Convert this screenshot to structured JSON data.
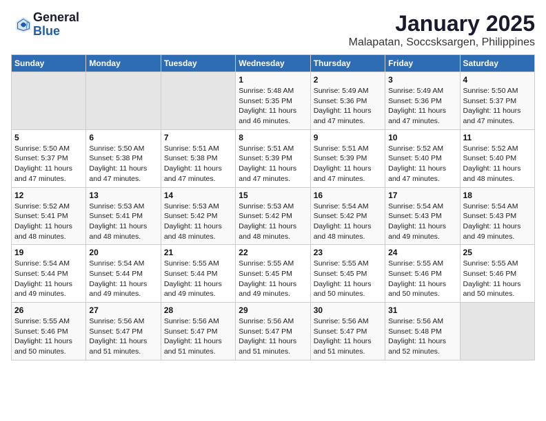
{
  "logo": {
    "general": "General",
    "blue": "Blue"
  },
  "title": "January 2025",
  "subtitle": "Malapatan, Soccsksargen, Philippines",
  "days_of_week": [
    "Sunday",
    "Monday",
    "Tuesday",
    "Wednesday",
    "Thursday",
    "Friday",
    "Saturday"
  ],
  "weeks": [
    [
      {
        "day": "",
        "info": ""
      },
      {
        "day": "",
        "info": ""
      },
      {
        "day": "",
        "info": ""
      },
      {
        "day": "1",
        "info": "Sunrise: 5:48 AM\nSunset: 5:35 PM\nDaylight: 11 hours and 46 minutes."
      },
      {
        "day": "2",
        "info": "Sunrise: 5:49 AM\nSunset: 5:36 PM\nDaylight: 11 hours and 47 minutes."
      },
      {
        "day": "3",
        "info": "Sunrise: 5:49 AM\nSunset: 5:36 PM\nDaylight: 11 hours and 47 minutes."
      },
      {
        "day": "4",
        "info": "Sunrise: 5:50 AM\nSunset: 5:37 PM\nDaylight: 11 hours and 47 minutes."
      }
    ],
    [
      {
        "day": "5",
        "info": "Sunrise: 5:50 AM\nSunset: 5:37 PM\nDaylight: 11 hours and 47 minutes."
      },
      {
        "day": "6",
        "info": "Sunrise: 5:50 AM\nSunset: 5:38 PM\nDaylight: 11 hours and 47 minutes."
      },
      {
        "day": "7",
        "info": "Sunrise: 5:51 AM\nSunset: 5:38 PM\nDaylight: 11 hours and 47 minutes."
      },
      {
        "day": "8",
        "info": "Sunrise: 5:51 AM\nSunset: 5:39 PM\nDaylight: 11 hours and 47 minutes."
      },
      {
        "day": "9",
        "info": "Sunrise: 5:51 AM\nSunset: 5:39 PM\nDaylight: 11 hours and 47 minutes."
      },
      {
        "day": "10",
        "info": "Sunrise: 5:52 AM\nSunset: 5:40 PM\nDaylight: 11 hours and 47 minutes."
      },
      {
        "day": "11",
        "info": "Sunrise: 5:52 AM\nSunset: 5:40 PM\nDaylight: 11 hours and 48 minutes."
      }
    ],
    [
      {
        "day": "12",
        "info": "Sunrise: 5:52 AM\nSunset: 5:41 PM\nDaylight: 11 hours and 48 minutes."
      },
      {
        "day": "13",
        "info": "Sunrise: 5:53 AM\nSunset: 5:41 PM\nDaylight: 11 hours and 48 minutes."
      },
      {
        "day": "14",
        "info": "Sunrise: 5:53 AM\nSunset: 5:42 PM\nDaylight: 11 hours and 48 minutes."
      },
      {
        "day": "15",
        "info": "Sunrise: 5:53 AM\nSunset: 5:42 PM\nDaylight: 11 hours and 48 minutes."
      },
      {
        "day": "16",
        "info": "Sunrise: 5:54 AM\nSunset: 5:42 PM\nDaylight: 11 hours and 48 minutes."
      },
      {
        "day": "17",
        "info": "Sunrise: 5:54 AM\nSunset: 5:43 PM\nDaylight: 11 hours and 49 minutes."
      },
      {
        "day": "18",
        "info": "Sunrise: 5:54 AM\nSunset: 5:43 PM\nDaylight: 11 hours and 49 minutes."
      }
    ],
    [
      {
        "day": "19",
        "info": "Sunrise: 5:54 AM\nSunset: 5:44 PM\nDaylight: 11 hours and 49 minutes."
      },
      {
        "day": "20",
        "info": "Sunrise: 5:54 AM\nSunset: 5:44 PM\nDaylight: 11 hours and 49 minutes."
      },
      {
        "day": "21",
        "info": "Sunrise: 5:55 AM\nSunset: 5:44 PM\nDaylight: 11 hours and 49 minutes."
      },
      {
        "day": "22",
        "info": "Sunrise: 5:55 AM\nSunset: 5:45 PM\nDaylight: 11 hours and 49 minutes."
      },
      {
        "day": "23",
        "info": "Sunrise: 5:55 AM\nSunset: 5:45 PM\nDaylight: 11 hours and 50 minutes."
      },
      {
        "day": "24",
        "info": "Sunrise: 5:55 AM\nSunset: 5:46 PM\nDaylight: 11 hours and 50 minutes."
      },
      {
        "day": "25",
        "info": "Sunrise: 5:55 AM\nSunset: 5:46 PM\nDaylight: 11 hours and 50 minutes."
      }
    ],
    [
      {
        "day": "26",
        "info": "Sunrise: 5:55 AM\nSunset: 5:46 PM\nDaylight: 11 hours and 50 minutes."
      },
      {
        "day": "27",
        "info": "Sunrise: 5:56 AM\nSunset: 5:47 PM\nDaylight: 11 hours and 51 minutes."
      },
      {
        "day": "28",
        "info": "Sunrise: 5:56 AM\nSunset: 5:47 PM\nDaylight: 11 hours and 51 minutes."
      },
      {
        "day": "29",
        "info": "Sunrise: 5:56 AM\nSunset: 5:47 PM\nDaylight: 11 hours and 51 minutes."
      },
      {
        "day": "30",
        "info": "Sunrise: 5:56 AM\nSunset: 5:47 PM\nDaylight: 11 hours and 51 minutes."
      },
      {
        "day": "31",
        "info": "Sunrise: 5:56 AM\nSunset: 5:48 PM\nDaylight: 11 hours and 52 minutes."
      },
      {
        "day": "",
        "info": ""
      }
    ]
  ]
}
